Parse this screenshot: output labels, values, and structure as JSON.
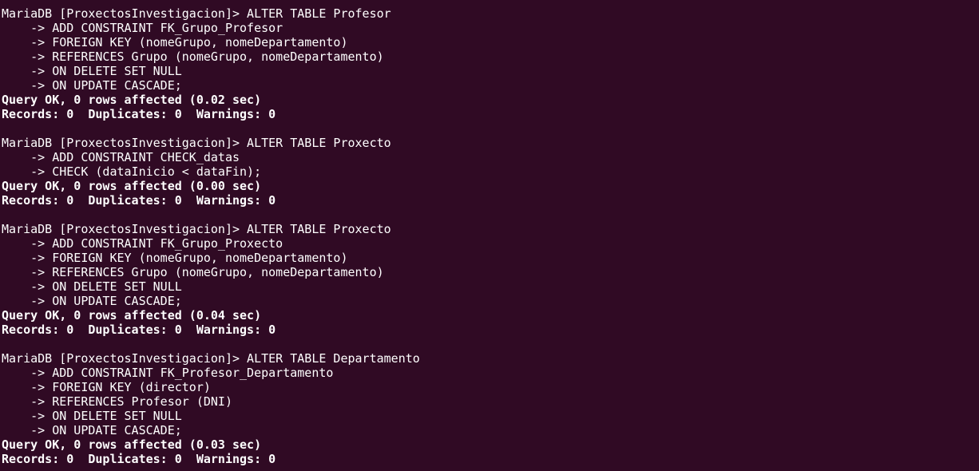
{
  "terminal": {
    "background": "#300a24",
    "foreground": "#ffffff",
    "lines": [
      {
        "text": "MariaDB [ProxectosInvestigacion]> ALTER TABLE Profesor",
        "bold": false
      },
      {
        "text": "    -> ADD CONSTRAINT FK_Grupo_Profesor",
        "bold": false
      },
      {
        "text": "    -> FOREIGN KEY (nomeGrupo, nomeDepartamento)",
        "bold": false
      },
      {
        "text": "    -> REFERENCES Grupo (nomeGrupo, nomeDepartamento)",
        "bold": false
      },
      {
        "text": "    -> ON DELETE SET NULL",
        "bold": false
      },
      {
        "text": "    -> ON UPDATE CASCADE;",
        "bold": false
      },
      {
        "text": "Query OK, 0 rows affected (0.02 sec)",
        "bold": true
      },
      {
        "text": "Records: 0  Duplicates: 0  Warnings: 0",
        "bold": true
      },
      {
        "text": "",
        "bold": false
      },
      {
        "text": "MariaDB [ProxectosInvestigacion]> ALTER TABLE Proxecto",
        "bold": false
      },
      {
        "text": "    -> ADD CONSTRAINT CHECK_datas",
        "bold": false
      },
      {
        "text": "    -> CHECK (dataInicio < dataFin);",
        "bold": false
      },
      {
        "text": "Query OK, 0 rows affected (0.00 sec)",
        "bold": true
      },
      {
        "text": "Records: 0  Duplicates: 0  Warnings: 0",
        "bold": true
      },
      {
        "text": "",
        "bold": false
      },
      {
        "text": "MariaDB [ProxectosInvestigacion]> ALTER TABLE Proxecto",
        "bold": false
      },
      {
        "text": "    -> ADD CONSTRAINT FK_Grupo_Proxecto",
        "bold": false
      },
      {
        "text": "    -> FOREIGN KEY (nomeGrupo, nomeDepartamento)",
        "bold": false
      },
      {
        "text": "    -> REFERENCES Grupo (nomeGrupo, nomeDepartamento)",
        "bold": false
      },
      {
        "text": "    -> ON DELETE SET NULL",
        "bold": false
      },
      {
        "text": "    -> ON UPDATE CASCADE;",
        "bold": false
      },
      {
        "text": "Query OK, 0 rows affected (0.04 sec)",
        "bold": true
      },
      {
        "text": "Records: 0  Duplicates: 0  Warnings: 0",
        "bold": true
      },
      {
        "text": "",
        "bold": false
      },
      {
        "text": "MariaDB [ProxectosInvestigacion]> ALTER TABLE Departamento",
        "bold": false
      },
      {
        "text": "    -> ADD CONSTRAINT FK_Profesor_Departamento",
        "bold": false
      },
      {
        "text": "    -> FOREIGN KEY (director)",
        "bold": false
      },
      {
        "text": "    -> REFERENCES Profesor (DNI)",
        "bold": false
      },
      {
        "text": "    -> ON DELETE SET NULL",
        "bold": false
      },
      {
        "text": "    -> ON UPDATE CASCADE;",
        "bold": false
      },
      {
        "text": "Query OK, 0 rows affected (0.03 sec)",
        "bold": true
      },
      {
        "text": "Records: 0  Duplicates: 0  Warnings: 0",
        "bold": true
      }
    ]
  }
}
